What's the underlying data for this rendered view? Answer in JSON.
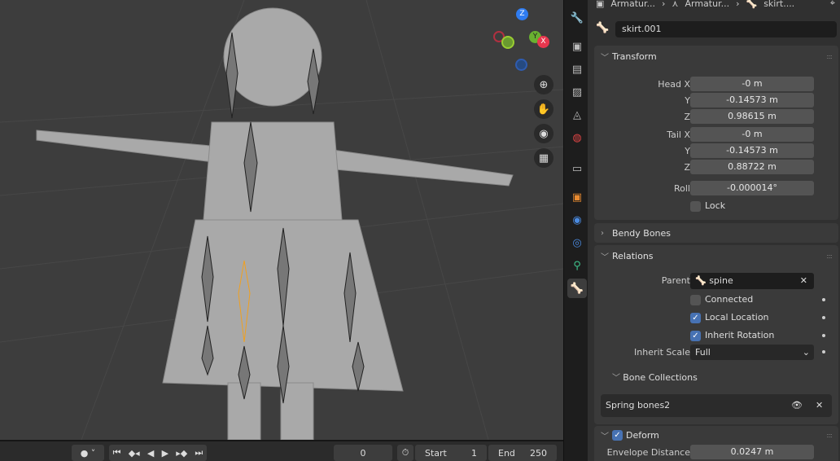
{
  "viewport": {
    "gizmo": {
      "z": "Z",
      "y": "Y",
      "x": "X"
    },
    "nav_icons": [
      "zoom-icon",
      "hand-pan-icon",
      "camera-icon",
      "grid-icon"
    ]
  },
  "timeline": {
    "current_frame": "0",
    "start_label": "Start",
    "start": "1",
    "end_label": "End",
    "end": "250"
  },
  "breadcrumb": [
    "Armatur...",
    "Armatur...",
    "skirt...."
  ],
  "bone_name": "skirt.001",
  "transform": {
    "title": "Transform",
    "head_x_label": "Head X",
    "head_x": "-0 m",
    "y_label": "Y",
    "head_y": "-0.14573 m",
    "z_label": "Z",
    "head_z": "0.98615 m",
    "tail_x_label": "Tail X",
    "tail_x": "-0 m",
    "tail_y": "-0.14573 m",
    "tail_z": "0.88722 m",
    "roll_label": "Roll",
    "roll": "-0.000014°",
    "lock_label": "Lock"
  },
  "bendy_bones": {
    "title": "Bendy Bones"
  },
  "relations": {
    "title": "Relations",
    "parent_label": "Parent",
    "parent": "spine",
    "connected_label": "Connected",
    "local_location_label": "Local Location",
    "inherit_rotation_label": "Inherit Rotation",
    "inherit_scale_label": "Inherit Scale",
    "inherit_scale": "Full",
    "bone_collections_title": "Bone Collections",
    "collection": "Spring bones2"
  },
  "deform": {
    "title": "Deform",
    "envelope_label": "Envelope Distance",
    "envelope": "0.0247 m"
  },
  "colors": {
    "accent": "#4772b3",
    "bone_selected": "#f0a020"
  }
}
